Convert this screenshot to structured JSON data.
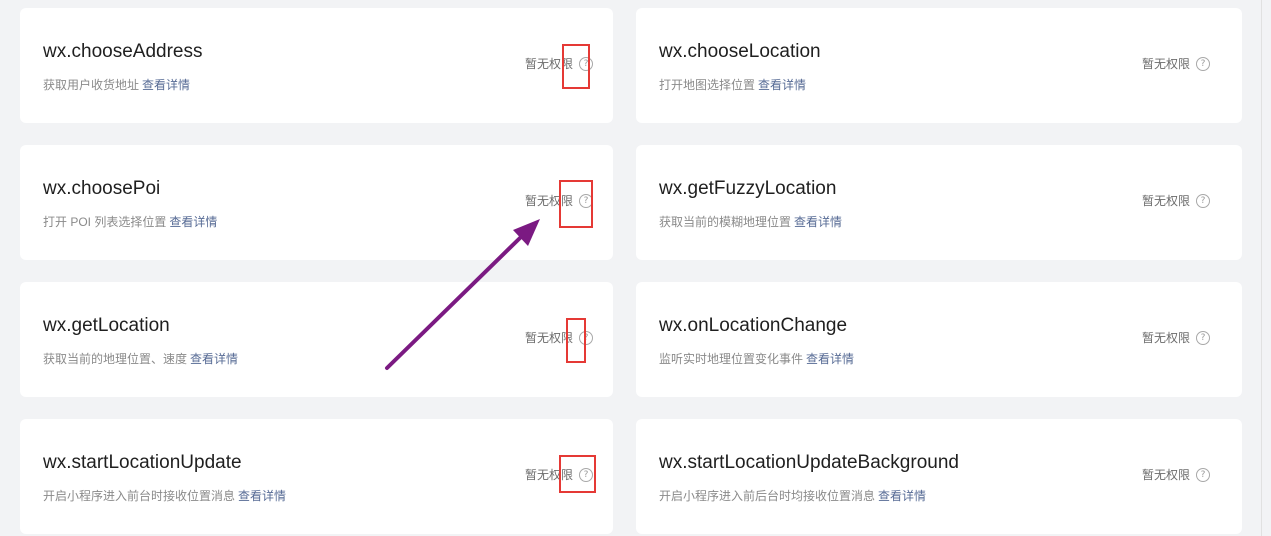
{
  "detail_link": "查看详情",
  "cards": [
    {
      "title": "wx.chooseAddress",
      "desc": "获取用户收货地址",
      "status": "暂无权限"
    },
    {
      "title": "wx.chooseLocation",
      "desc": "打开地图选择位置",
      "status": "暂无权限"
    },
    {
      "title": "wx.choosePoi",
      "desc": "打开 POI 列表选择位置",
      "status": "暂无权限"
    },
    {
      "title": "wx.getFuzzyLocation",
      "desc": "获取当前的模糊地理位置",
      "status": "暂无权限"
    },
    {
      "title": "wx.getLocation",
      "desc": "获取当前的地理位置、速度",
      "status": "暂无权限"
    },
    {
      "title": "wx.onLocationChange",
      "desc": "监听实时地理位置变化事件",
      "status": "暂无权限"
    },
    {
      "title": "wx.startLocationUpdate",
      "desc": "开启小程序进入前台时接收位置消息",
      "status": "暂无权限"
    },
    {
      "title": "wx.startLocationUpdateBackground",
      "desc": "开启小程序进入前后台时均接收位置消息",
      "status": "暂无权限"
    }
  ],
  "help_icon": "question-circle-icon",
  "colors": {
    "background": "#f2f3f5",
    "card": "#ffffff",
    "link": "#576b95",
    "highlight": "#e53935",
    "arrow": "#7b1a82"
  }
}
